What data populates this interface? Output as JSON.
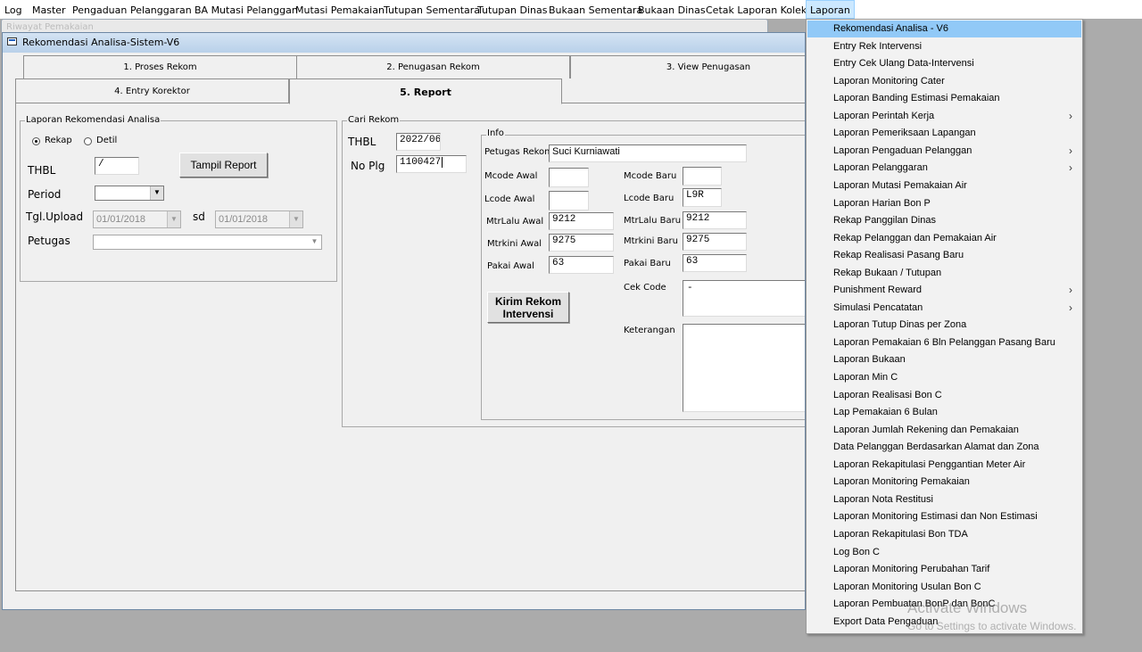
{
  "menubar": {
    "items": [
      "Log",
      "Master",
      "Pengaduan",
      "Pelanggaran",
      "BA Mutasi Pelanggan",
      "Mutasi Pemakaian",
      "Tutupan Sementara",
      "Tutupan Dinas",
      "Bukaan Sementara",
      "Bukaan Dinas",
      "Cetak Laporan Kolektif",
      "Laporan"
    ],
    "active": "Laporan"
  },
  "background_window": {
    "title": "Riwayat Pemakaian"
  },
  "window": {
    "title": "Rekomendasi Analisa-Sistem-V6"
  },
  "tabs": {
    "row1": [
      "1. Proses Rekom",
      "2. Penugasan Rekom",
      "3. View Penugasan"
    ],
    "row2": [
      "4. Entry Korektor",
      "5. Report"
    ],
    "selected": "5. Report"
  },
  "report_group": {
    "title": "Laporan Rekomendasi Analisa",
    "radio_rekap": "Rekap",
    "radio_detil": "Detil",
    "selected_radio": "Rekap",
    "thbl_label": "THBL",
    "thbl_value": " /",
    "period_label": "Period",
    "period_value": "",
    "tgl_upload_label": "Tgl.Upload",
    "tgl_from": "01/01/2018",
    "sd_label": "sd",
    "tgl_to": "01/01/2018",
    "petugas_label": "Petugas",
    "petugas_value": "",
    "tampil_button": "Tampil Report"
  },
  "cari_group": {
    "title": "Cari Rekom",
    "thbl_label": "THBL",
    "thbl_value": "2022/06",
    "noplg_label": "No Plg",
    "noplg_value": "1100427",
    "kirim_button_line1": "Kirim Rekom",
    "kirim_button_line2": "Intervensi"
  },
  "info_group": {
    "title": "Info",
    "petugas_label": "Petugas Rekom",
    "petugas_value": "Suci Kurniawati",
    "mcode_awal_label": "Mcode Awal",
    "mcode_awal": "",
    "lcode_awal_label": "Lcode Awal",
    "lcode_awal": "",
    "mtrlalu_awal_label": "MtrLalu Awal",
    "mtrlalu_awal": "9212",
    "mtrkini_awal_label": "Mtrkini Awal",
    "mtrkini_awal": "9275",
    "pakai_awal_label": "Pakai Awal",
    "pakai_awal": "63",
    "mcode_baru_label": "Mcode Baru",
    "mcode_baru": "",
    "lcode_baru_label": "Lcode Baru",
    "lcode_baru": "L9R",
    "mtrlalu_baru_label": "MtrLalu Baru",
    "mtrlalu_baru": "9212",
    "mtrkini_baru_label": "Mtrkini Baru",
    "mtrkini_baru": "9275",
    "pakai_baru_label": "Pakai Baru",
    "pakai_baru": "63",
    "cek_code_label": "Cek Code",
    "cek_code": "-",
    "keterangan_label": "Keterangan",
    "keterangan": ""
  },
  "laporan_menu": {
    "items": [
      {
        "label": "Rekomendasi Analisa - V6",
        "submenu": false,
        "highlighted": true
      },
      {
        "label": "Entry Rek Intervensi",
        "submenu": false
      },
      {
        "label": "Entry Cek Ulang Data-Intervensi",
        "submenu": false
      },
      {
        "label": "Laporan Monitoring Cater",
        "submenu": false
      },
      {
        "label": "Laporan Banding Estimasi Pemakaian",
        "submenu": false
      },
      {
        "label": "Laporan Perintah Kerja",
        "submenu": true
      },
      {
        "label": "Laporan Pemeriksaan Lapangan",
        "submenu": false
      },
      {
        "label": "Laporan Pengaduan Pelanggan",
        "submenu": true
      },
      {
        "label": "Laporan Pelanggaran",
        "submenu": true
      },
      {
        "label": "Laporan Mutasi Pemakaian Air",
        "submenu": false
      },
      {
        "label": "Laporan Harian Bon P",
        "submenu": false
      },
      {
        "label": "Rekap Panggilan Dinas",
        "submenu": false
      },
      {
        "label": "Rekap Pelanggan dan Pemakaian Air",
        "submenu": false
      },
      {
        "label": "Rekap Realisasi Pasang Baru",
        "submenu": false
      },
      {
        "label": "Rekap Bukaan / Tutupan",
        "submenu": false
      },
      {
        "label": "Punishment Reward",
        "submenu": true
      },
      {
        "label": "Simulasi Pencatatan",
        "submenu": true
      },
      {
        "label": "Laporan Tutup Dinas per Zona",
        "submenu": false
      },
      {
        "label": "Laporan Pemakaian 6 Bln Pelanggan Pasang Baru",
        "submenu": false
      },
      {
        "label": "Laporan Bukaan",
        "submenu": false
      },
      {
        "label": "Laporan Min C",
        "submenu": false
      },
      {
        "label": "Laporan Realisasi Bon C",
        "submenu": false
      },
      {
        "label": "Lap Pemakaian 6 Bulan",
        "submenu": false
      },
      {
        "label": "Laporan Jumlah Rekening dan Pemakaian",
        "submenu": false
      },
      {
        "label": "Data Pelanggan Berdasarkan Alamat dan Zona",
        "submenu": false
      },
      {
        "label": "Laporan Rekapitulasi Penggantian Meter Air",
        "submenu": false
      },
      {
        "label": "Laporan Monitoring Pemakaian",
        "submenu": false
      },
      {
        "label": "Laporan Nota Restitusi",
        "submenu": false
      },
      {
        "label": "Laporan Monitoring Estimasi dan Non Estimasi",
        "submenu": false
      },
      {
        "label": "Laporan Rekapitulasi Bon TDA",
        "submenu": false
      },
      {
        "label": "Log Bon C",
        "submenu": false
      },
      {
        "label": "Laporan Monitoring Perubahan Tarif",
        "submenu": false
      },
      {
        "label": "Laporan Monitoring Usulan Bon C",
        "submenu": false
      },
      {
        "label": "Laporan Pembuatan BonP dan BonC",
        "submenu": false
      },
      {
        "label": "Export Data Pengaduan",
        "submenu": false
      }
    ]
  },
  "watermark": {
    "line1": "Activate Windows",
    "line2": "Go to Settings to activate Windows."
  }
}
